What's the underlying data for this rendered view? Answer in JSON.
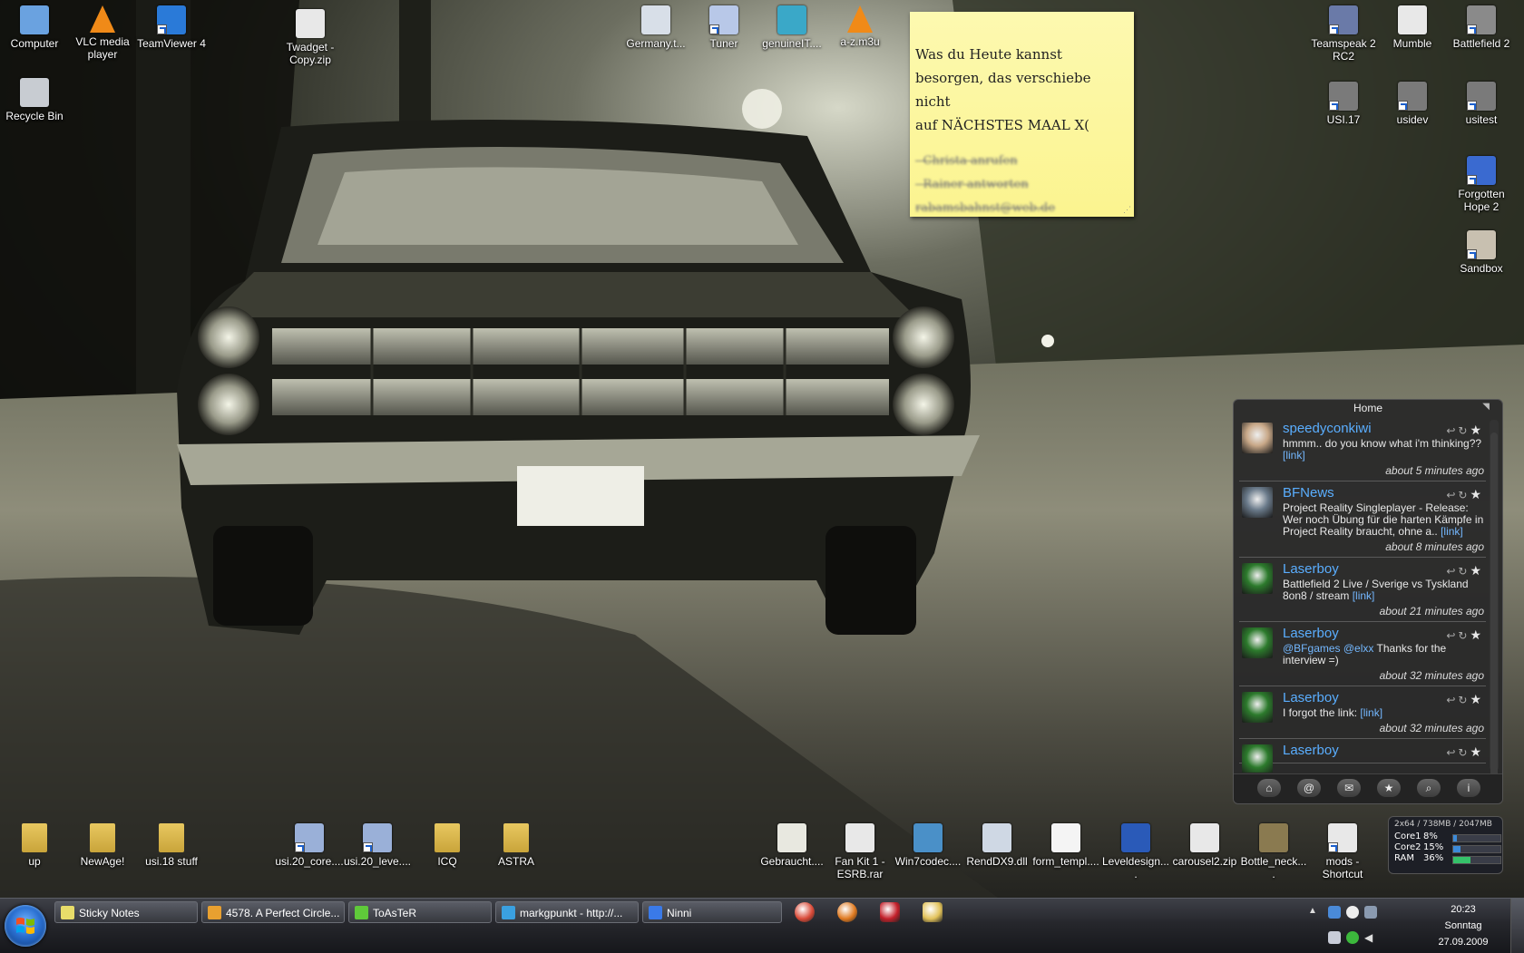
{
  "desktop": {
    "icons": [
      {
        "label": "Computer",
        "icon": "computer-icon"
      },
      {
        "label": "VLC media player",
        "icon": "vlc-cone-icon"
      },
      {
        "label": "TeamViewer 4",
        "icon": "teamviewer-icon"
      },
      {
        "label": "Twadget - Copy.zip",
        "icon": "zip-file-icon"
      },
      {
        "label": "Germany.t...",
        "icon": "file-icon"
      },
      {
        "label": "Tuner",
        "icon": "tuner-icon"
      },
      {
        "label": "genuineIT....",
        "icon": "puzzle-icon"
      },
      {
        "label": "a-z.m3u",
        "icon": "vlc-cone-icon"
      },
      {
        "label": "Recycle Bin",
        "icon": "recycle-bin-icon"
      },
      {
        "label": "Teamspeak 2 RC2",
        "icon": "teamspeak-icon"
      },
      {
        "label": "Mumble",
        "icon": "mumble-icon"
      },
      {
        "label": "Battlefield 2",
        "icon": "battlefield-icon"
      },
      {
        "label": "USI.17",
        "icon": "usi-icon"
      },
      {
        "label": "usidev",
        "icon": "usi-icon"
      },
      {
        "label": "usitest",
        "icon": "usi-icon"
      },
      {
        "label": "Forgotten Hope 2",
        "icon": "fh2-icon"
      },
      {
        "label": "Sandbox",
        "icon": "sandbox-icon"
      },
      {
        "label": "up",
        "icon": "folder-icon"
      },
      {
        "label": "NewAge!",
        "icon": "folder-icon"
      },
      {
        "label": "usi.18 stuff",
        "icon": "folder-icon"
      },
      {
        "label": "usi.20_core....",
        "icon": "installer-icon"
      },
      {
        "label": "usi.20_leve....",
        "icon": "installer-icon"
      },
      {
        "label": "ICQ",
        "icon": "folder-icon"
      },
      {
        "label": "ASTRA",
        "icon": "folder-icon"
      },
      {
        "label": "Gebraucht....",
        "icon": "document-icon"
      },
      {
        "label": "Fan Kit 1 - ESRB.rar",
        "icon": "zip-file-icon"
      },
      {
        "label": "Win7codec....",
        "icon": "codec-icon"
      },
      {
        "label": "RendDX9.dll",
        "icon": "dll-icon"
      },
      {
        "label": "form_templ....",
        "icon": "blank-document-icon"
      },
      {
        "label": "Leveldesign....",
        "icon": "word-document-icon"
      },
      {
        "label": "carousel2.zip",
        "icon": "zip-file-icon"
      },
      {
        "label": "Bottle_neck....",
        "icon": "image-file-icon"
      },
      {
        "label": "mods - Shortcut",
        "icon": "shortcut-icon"
      }
    ]
  },
  "sticky_note": {
    "lines": [
      "Was du Heute kannst",
      "besorgen, das verschiebe nicht",
      "auf NÄCHSTES MAAL X("
    ],
    "struck_lines": [
      "- Christa anrufen",
      "- Rainer antworten",
      "rabamsbahnst@web.de"
    ]
  },
  "twitter": {
    "title": "Home",
    "tweets": [
      {
        "user": "speedyconkiwi",
        "text": "hmmm.. do you know what i'm thinking??",
        "link": "[link]",
        "time": "about 5 minutes ago"
      },
      {
        "user": "BFNews",
        "text": "Project Reality Singleplayer - Release: Wer noch Übung für die harten Kämpfe in Project Reality braucht, ohne a..",
        "link": "[link]",
        "time": "about 8 minutes ago"
      },
      {
        "user": "Laserboy",
        "text": "Battlefield 2 Live / Sverige vs Tyskland 8on8 / stream",
        "link": "[link]",
        "time": "about 21 minutes ago"
      },
      {
        "user": "Laserboy",
        "mentions": "@BFgames @elxx",
        "text": "Thanks for the interview =)",
        "link": "",
        "time": "about 32 minutes ago"
      },
      {
        "user": "Laserboy",
        "text": "I forgot the link:",
        "link": "[link]",
        "time": "about 32 minutes ago"
      },
      {
        "user": "Laserboy",
        "text": "",
        "link": "",
        "time": ""
      }
    ],
    "toolbar": [
      "home-icon",
      "at-icon",
      "mail-icon",
      "star-icon",
      "search-icon",
      "info-icon"
    ]
  },
  "cpu_meter": {
    "header": "2x64 / 738MB / 2047MB",
    "rows": [
      {
        "label": "Core1",
        "value": "8%",
        "fraction": 0.08,
        "color": "#3c8ad8"
      },
      {
        "label": "Core2",
        "value": "15%",
        "fraction": 0.15,
        "color": "#3c8ad8"
      },
      {
        "label": "RAM",
        "value": "36%",
        "fraction": 0.36,
        "color": "#35c26a"
      }
    ]
  },
  "taskbar": {
    "buttons": [
      {
        "label": "Sticky Notes",
        "color": "#e8dd6a"
      },
      {
        "label": "4578. A Perfect Circle...",
        "color": "#e8a030"
      },
      {
        "label": "ToAsTeR",
        "color": "#5fc93a"
      },
      {
        "label": "markgpunkt - http://...",
        "color": "#3aa0e0"
      },
      {
        "label": "Ninni",
        "color": "#3a7ae8"
      }
    ],
    "pinned": [
      {
        "name": "chrome-icon",
        "color": "#d94a38"
      },
      {
        "name": "firefox-icon",
        "color": "#e07a20"
      },
      {
        "name": "filezilla-icon",
        "color": "#c4202a"
      },
      {
        "name": "explorer-folder-icon",
        "color": "#e2c25a"
      }
    ],
    "clock": {
      "time": "20:23",
      "day": "Sonntag",
      "date": "27.09.2009"
    }
  }
}
